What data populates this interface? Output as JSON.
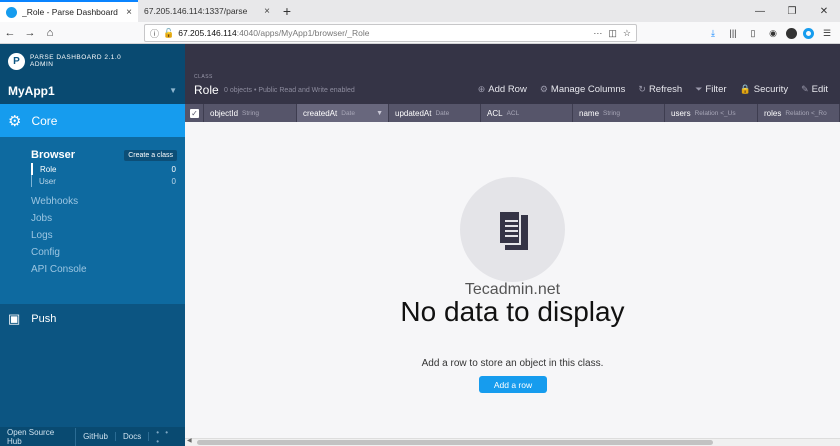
{
  "browser": {
    "tabs": [
      {
        "label": "_Role - Parse Dashboard",
        "close": "×"
      },
      {
        "label": "67.205.146.114:1337/parse",
        "close": "×"
      }
    ],
    "new_tab": "+",
    "window_controls": [
      "—",
      "❐",
      "✕"
    ],
    "url": {
      "host": "67.205.146.114",
      "path": ":4040/apps/MyApp1/browser/_Role"
    }
  },
  "sidebar": {
    "brand": [
      "PARSE DASHBOARD 2.1.0",
      "ADMIN"
    ],
    "app_name": "MyApp1",
    "core_label": "Core",
    "browser_label": "Browser",
    "create_class": "Create a class",
    "classes": [
      {
        "name": "Role",
        "count": "0"
      },
      {
        "name": "User",
        "count": "0"
      }
    ],
    "menu": [
      "Webhooks",
      "Jobs",
      "Logs",
      "Config",
      "API Console"
    ],
    "push_label": "Push",
    "footer": [
      "Open Source Hub",
      "GitHub",
      "Docs",
      "• • •"
    ]
  },
  "header": {
    "class_caption": "CLASS",
    "class_name": "Role",
    "subtitle": "0 objects • Public Read and Write enabled",
    "actions": [
      {
        "label": "Add Row",
        "icon": "⊕"
      },
      {
        "label": "Manage Columns",
        "icon": "⚙"
      },
      {
        "label": "Refresh",
        "icon": "↻"
      },
      {
        "label": "Filter",
        "icon": "⏷"
      },
      {
        "label": "Security",
        "icon": "🔒"
      },
      {
        "label": "Edit",
        "icon": "✎"
      }
    ]
  },
  "columns": [
    {
      "name": "objectId",
      "type": "String"
    },
    {
      "name": "createdAt",
      "type": "Date"
    },
    {
      "name": "updatedAt",
      "type": "Date"
    },
    {
      "name": "ACL",
      "type": "ACL"
    },
    {
      "name": "name",
      "type": "String"
    },
    {
      "name": "users",
      "type": "Relation <_Us"
    },
    {
      "name": "roles",
      "type": "Relation <_Ro"
    }
  ],
  "empty": {
    "watermark": "Tecadmin.net",
    "title": "No data to display",
    "hint": "Add a row to store an object in this class.",
    "button": "Add a row"
  }
}
